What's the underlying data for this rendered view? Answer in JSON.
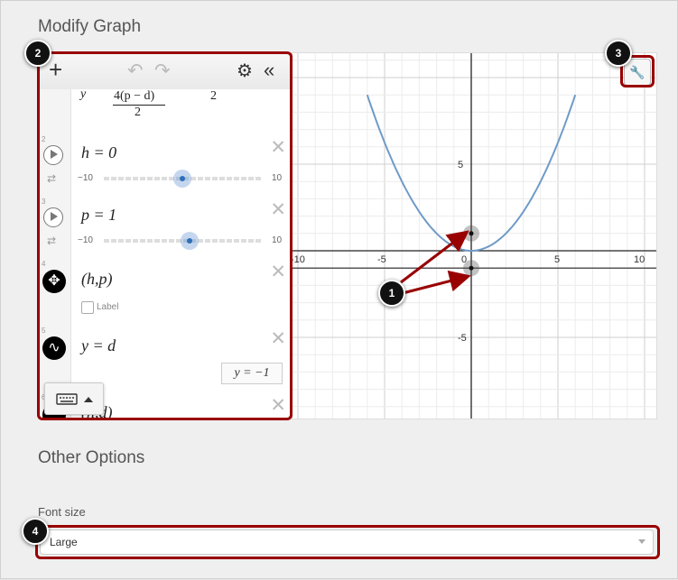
{
  "modify_graph": {
    "title": "Modify Graph"
  },
  "other_options": {
    "title": "Other Options"
  },
  "font_size": {
    "label": "Font size",
    "value": "Large"
  },
  "toolbar": {
    "add_icon": "plus-icon",
    "undo_icon": "undo-icon",
    "redo_icon": "redo-icon",
    "settings_icon": "gear-icon",
    "collapse_icon": "double-chevron-left-icon"
  },
  "expressions": {
    "e1": {
      "lhs": "y",
      "num": "4(p − d)",
      "den": "2",
      "tail": "2"
    },
    "e2": {
      "number": "2",
      "math": "h = 0",
      "min": "−10",
      "max": "10",
      "value": 0
    },
    "e3": {
      "number": "3",
      "math": "p = 1",
      "min": "−10",
      "max": "10",
      "value": 1
    },
    "e4": {
      "number": "4",
      "math": "(h,p)",
      "label_checkbox": "Label"
    },
    "e5": {
      "number": "5",
      "math": "y = d",
      "value_display": "y = −1"
    },
    "e6": {
      "number": "6",
      "math": "(h,d)"
    }
  },
  "graph": {
    "x_ticks": [
      "-10",
      "-5",
      "0",
      "5",
      "10"
    ],
    "y_ticks": [
      "5",
      "-5"
    ],
    "curve_color": "#6f9bc8",
    "points": [
      {
        "x": 0,
        "y": 1
      },
      {
        "x": 0,
        "y": -1
      }
    ]
  },
  "callouts": {
    "c1": "1",
    "c2": "2",
    "c3": "3",
    "c4": "4"
  },
  "colors": {
    "highlight": "#990000",
    "arrow": "#990000"
  }
}
